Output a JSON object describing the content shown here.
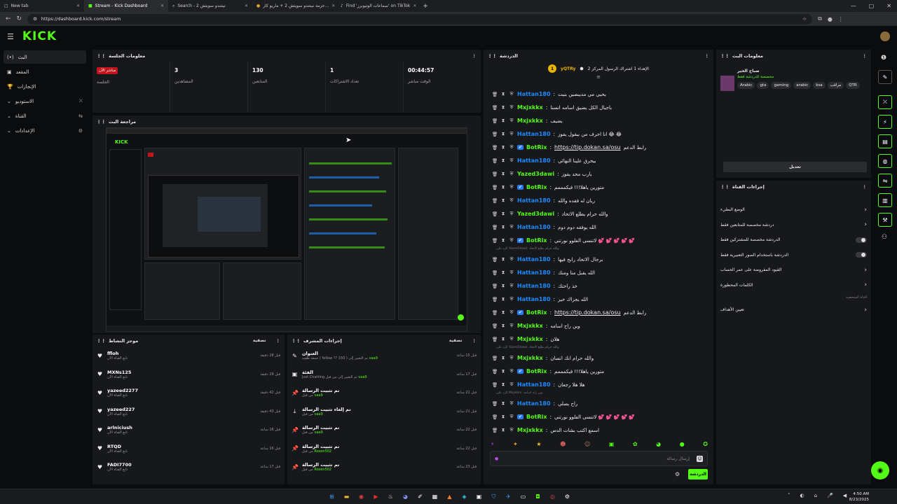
{
  "browser": {
    "tabs": [
      {
        "title": "New tab",
        "icon": "tab-icon"
      },
      {
        "title": "Stream - Kick Dashboard",
        "icon": "kick-icon"
      },
      {
        "title": "Search - 2 نينتندو سويتش",
        "icon": "search-icon"
      },
      {
        "title": "حزمة نينتندو سويتش 2 + ماريو كار...",
        "icon": "shop-icon"
      },
      {
        "title": "Find 'سماعات الوتيوبرز' on TikTok",
        "icon": "tiktok-icon"
      }
    ],
    "url": "https://dashboard.kick.com/stream"
  },
  "app": {
    "logo": "KICK",
    "accent": "#53fc18"
  },
  "sidebar": {
    "items": [
      {
        "label": "البث",
        "prefix": "(•)",
        "active": true
      },
      {
        "label": "المقعد",
        "prefix": "▣"
      },
      {
        "label": "الإنجازات",
        "prefix": "🏆"
      },
      {
        "label": "الاستوديو",
        "prefix": "⌄",
        "right": "⛌"
      },
      {
        "label": "القناة",
        "prefix": "⌄",
        "right": "⇆"
      },
      {
        "label": "الإعدادات",
        "prefix": "⌄",
        "right": "⚙"
      }
    ]
  },
  "session": {
    "title": "معلومات الجلسة",
    "live_badge": "مباشر الآن",
    "session_label": "الجلسة",
    "stats": [
      {
        "value": "3",
        "label": "المشاهدين"
      },
      {
        "value": "130",
        "label": "المتابعين"
      },
      {
        "value": "1",
        "label": "تعداد الاشتراكات"
      },
      {
        "value": "00:44:57",
        "label": "الوقت مباشر"
      }
    ]
  },
  "preview": {
    "title": "مراجعة البث"
  },
  "activity": {
    "title": "موجز النشاط",
    "filter": "تصفية",
    "rows": [
      {
        "name": "ffloh",
        "desc": "تابع القناة الآن",
        "time": "قبل 28 دقيقة"
      },
      {
        "name": "MXNs125",
        "desc": "تابع القناة الآن",
        "time": "قبل 29 دقيقة"
      },
      {
        "name": "yazeed2277",
        "desc": "تابع القناة الآن",
        "time": "قبل 42 دقيقة"
      },
      {
        "name": "yazeed227",
        "desc": "تابع القناة الآن",
        "time": "قبل 43 دقيقة"
      },
      {
        "name": "arlniciush",
        "desc": "تابع القناة الآن",
        "time": "قبل 16 ساعة"
      },
      {
        "name": "RTQD",
        "desc": "تابع القناة الآن",
        "time": "قبل 16 ساعة"
      },
      {
        "name": "FADI7700",
        "desc": "تابع القناة الآن",
        "time": "قبل 17 ساعة"
      }
    ]
  },
  "modactions": {
    "title": "إجراءات المشرف",
    "filter": "تصفية",
    "rows": [
      {
        "icon": "title-icon",
        "glyph": "✎",
        "name": "العنوان",
        "desc": "جمعة طقيه ( follow ?? 150 ) تم التغيير إلى",
        "by": "vaa9",
        "time": "قبل 15 ساعة"
      },
      {
        "icon": "category-icon",
        "glyph": "▣",
        "name": "الفئة",
        "desc": "Just Chatting تم التغيير إلى من قبل",
        "by": "vaa9",
        "time": "قبل 17 ساعة"
      },
      {
        "icon": "pin-icon",
        "glyph": "📌",
        "name": "تم تثبيت الرسالة",
        "desc": "من قبل",
        "by": "vaa9",
        "time": "قبل 21 ساعة"
      },
      {
        "icon": "unpin-icon",
        "glyph": "⤓",
        "name": "تم إلغاء تثبيت الرسالة",
        "desc": "من قبل",
        "by": "vaa9",
        "time": "قبل 21 ساعة"
      },
      {
        "icon": "pin-icon",
        "glyph": "📌",
        "name": "تم تثبيت الرسالة",
        "desc": "من قبل",
        "by": "vaa9",
        "time": "قبل 22 ساعة"
      },
      {
        "icon": "pin-icon",
        "glyph": "📌",
        "name": "تم تثبيت الرسالة",
        "desc": "من قبل",
        "by": "Roxen502",
        "time": "قبل 22 ساعة"
      },
      {
        "icon": "pin-icon",
        "glyph": "📌",
        "name": "تم تثبيت الرسالة",
        "desc": "من قبل",
        "by": "Roxen502",
        "time": "قبل 23 ساعة"
      }
    ]
  },
  "chat": {
    "title": "الدردشة",
    "goal_user": "yQTRy",
    "goal_count": "1",
    "goal_text": "الإهداء 1 اشتراك الرسول المركز 2",
    "input_placeholder": "إرسال رسالة",
    "send_label": "الدردشة",
    "messages": [
      {
        "type": "msg",
        "user": "Hattan180",
        "color": "#1a8cff",
        "text": "يحيي مي مديبصين بنيت"
      },
      {
        "type": "msg",
        "user": "Mxjxkkx",
        "color": "#53fc18",
        "text": "باجيال الكل يضيق اسامه انسنا"
      },
      {
        "type": "msg",
        "user": "Mxjxkkx",
        "color": "#53fc18",
        "text": "يضيف"
      },
      {
        "type": "msg",
        "user": "Hattan180",
        "color": "#1a8cff",
        "text": "انا احرف من بيقول يفوز 😂 😂"
      },
      {
        "type": "link",
        "user": "BotRix",
        "color": "#53fc18",
        "link": "https://tip.dokan.sa/osu",
        "text": "رابط الدعم"
      },
      {
        "type": "msg",
        "user": "Hattan180",
        "color": "#1a8cff",
        "text": "بيحرق علينا النهائي"
      },
      {
        "type": "msg",
        "user": "Yazed3dawi",
        "color": "#53fc18",
        "text": "يارب محد يفوز"
      },
      {
        "type": "msg",
        "user": "BotRix",
        "color": "#53fc18",
        "text": "متورين ياهلا!!! فيكمممم"
      },
      {
        "type": "msg",
        "user": "Hattan180",
        "color": "#1a8cff",
        "text": "ريان له فقده والله"
      },
      {
        "type": "msg",
        "user": "Yazed3dawi",
        "color": "#53fc18",
        "text": "والله حرام يطلع الاتحاد"
      },
      {
        "type": "msg",
        "user": "Hattan180",
        "color": "#1a8cff",
        "text": "الله يوفقه دوم دوم"
      },
      {
        "type": "msg",
        "user": "BotRix",
        "color": "#53fc18",
        "text": "لاتنسى الفلوو نورتني 💕 💕 💕 💕 💕"
      },
      {
        "type": "reply",
        "text": "الرد على Yazed3dawi: والله حرام يطلع الاتحاد"
      },
      {
        "type": "msg",
        "user": "Hattan180",
        "color": "#1a8cff",
        "text": "برجال الاتحاد رابح فيها"
      },
      {
        "type": "msg",
        "user": "Hattan180",
        "color": "#1a8cff",
        "text": "الله يقبل منا ومنك"
      },
      {
        "type": "msg",
        "user": "Hattan180",
        "color": "#1a8cff",
        "text": "خذ راحتك"
      },
      {
        "type": "msg",
        "user": "Hattan180",
        "color": "#1a8cff",
        "text": "الله يجزاك خير"
      },
      {
        "type": "link",
        "user": "BotRix",
        "color": "#53fc18",
        "link": "https://tip.dokan.sa/osu",
        "text": "رابط الدعم"
      },
      {
        "type": "msg",
        "user": "Mxjxkkx",
        "color": "#53fc18",
        "text": "وين راح اسامه"
      },
      {
        "type": "msg",
        "user": "Mxjxkkx",
        "color": "#53fc18",
        "text": "هلان"
      },
      {
        "type": "reply",
        "text": "الرد على Yazed3dawi: والله حرام يطلع الاتحاد"
      },
      {
        "type": "msg",
        "user": "Mxjxkkx",
        "color": "#53fc18",
        "text": "والله حرام انك انسان"
      },
      {
        "type": "msg",
        "user": "BotRix",
        "color": "#53fc18",
        "text": "متورين ياهلا!!! فيكمممم"
      },
      {
        "type": "msg",
        "user": "Hattan180",
        "color": "#1a8cff",
        "text": "هلا هلا رجعان"
      },
      {
        "type": "reply",
        "text": "الرد على Mxjxkkx: وين راح اسامه"
      },
      {
        "type": "msg",
        "user": "Hattan180",
        "color": "#1a8cff",
        "text": "راح يصلي"
      },
      {
        "type": "msg",
        "user": "BotRix",
        "color": "#53fc18",
        "text": "لاتنسى الفلوو نورتني 💕 💕 💕 💕 💕"
      },
      {
        "type": "msg",
        "user": "Mxjxkkx",
        "color": "#53fc18",
        "text": "اسمع اكتب بشات الدس"
      }
    ]
  },
  "streaminfo": {
    "title": "معلومات البث",
    "stream_title": "صباح الخير",
    "subtitle": "مخصصة للدردشة فقط",
    "tags": [
      "Arabic",
      "gta",
      "gaming",
      "arabic",
      "ksa",
      "مراقب",
      "QTR"
    ],
    "edit_label": "تعديل"
  },
  "channelactions": {
    "title": "إجراءات القناة",
    "items": [
      {
        "label": "الوضع البطيء",
        "control": "chevron"
      },
      {
        "label": "دردشة مخصصة للمتابعين فقط",
        "control": "chevron"
      },
      {
        "label": "الدردشة مخصصة للمشتركين فقط",
        "control": "toggle"
      },
      {
        "label": "الدردشة باستخدام الصور التعبيرية فقط",
        "control": "toggle"
      },
      {
        "label": "القيود المفروضة على عمر الحساب",
        "control": "chevron"
      },
      {
        "label": "الكلمات المحظورة",
        "control": "chevron"
      }
    ],
    "section_label": "أقناة الشخصية",
    "goals_label": "تعيين الأهداف"
  },
  "taskbar": {
    "time": "4:50 AM",
    "date": "8/23/2025"
  }
}
